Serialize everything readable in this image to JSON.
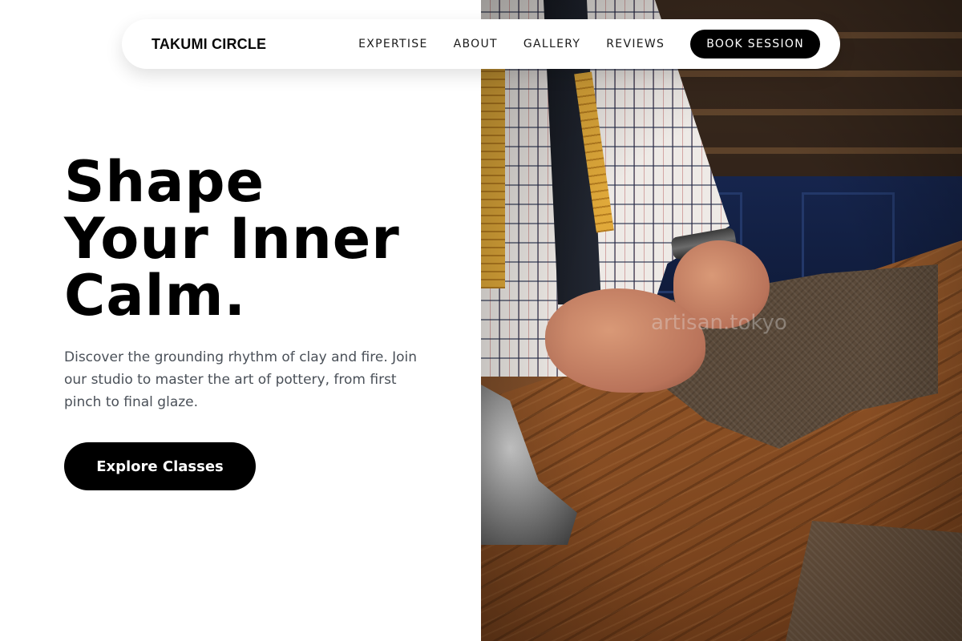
{
  "nav": {
    "brand": "TAKUMI CIRCLE",
    "links": [
      "EXPERTISE",
      "ABOUT",
      "GALLERY",
      "REVIEWS"
    ],
    "cta_label": "BOOK SESSION"
  },
  "hero": {
    "headline": [
      "Shape",
      "Your Inner",
      "Calm."
    ],
    "description": "Discover the grounding rhythm of clay and fire. Join our studio to master the art of pottery, from first pinch to final glaze.",
    "cta_label": "Explore Classes"
  },
  "photo": {
    "watermark": "artisan.tokyo"
  },
  "colors": {
    "primary": "#000000",
    "background": "#ffffff",
    "body_text": "#4a5058"
  }
}
